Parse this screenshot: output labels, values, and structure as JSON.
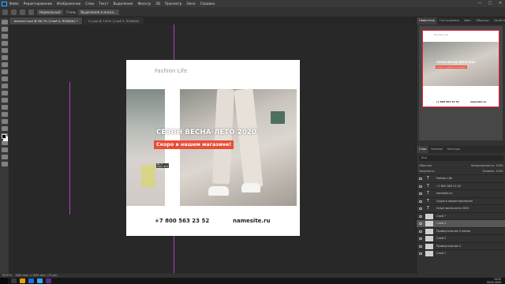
{
  "menu": {
    "items": [
      "Файл",
      "Редактирование",
      "Изображение",
      "Слои",
      "Текст",
      "Выделение",
      "Фильтр",
      "3D",
      "Просмотр",
      "Окно",
      "Справка"
    ],
    "window_controls": {
      "minimize": "—",
      "maximize": "□",
      "close": "✕"
    }
  },
  "options_bar": {
    "mode_label": "Нормальный",
    "style_label": "Стиль",
    "mask_button": "Выделение и маска..."
  },
  "tabs": [
    {
      "label": "banner2.psd @ 66,7% (Слой 4, RGB/8#) *",
      "active": true
    },
    {
      "label": "11.psd @ 100% (Слой 3, RGB/8#)",
      "active": false
    }
  ],
  "document": {
    "brand": "Fashion Life",
    "headline": "СЕЗОН ВЕСНА-ЛЕТО 2020",
    "cta": "Скоро в нашем магазине!",
    "phone": "+7 800 563 23 52",
    "site": "namesite.ru",
    "selection_hint": "Ш: 0 пикс. В: 0 пикс."
  },
  "colors": {
    "cta_bg": "#ea4c36",
    "guide": "#b040c0",
    "panel_bg": "#323232",
    "canvas_bg": "#282828"
  },
  "navigator": {
    "tabs": [
      "Навигатор",
      "Гистограмма",
      "Цвет",
      "Образцы",
      "Свойства"
    ],
    "thumb": {
      "brand": "Fashion Life",
      "headline": "СЕЗОН ВЕСНА-ЛЕТО 2020",
      "cta": "Скоро в нашем магазине!",
      "phone": "+7 800 563 23 52",
      "site": "namesite.ru"
    }
  },
  "layers_panel": {
    "tabs": [
      "Слои",
      "Каналы",
      "Контуры"
    ],
    "search_placeholder": "Вид",
    "blend_mode": "Обычные",
    "opacity": "Непрозрачность: 100%",
    "lock_label": "Закрепить:",
    "fill": "Заливка: 100%",
    "layers": [
      {
        "name": "Fashion Life",
        "type": "text",
        "selected": false
      },
      {
        "name": "+7 800 563 23 52",
        "type": "text",
        "selected": false
      },
      {
        "name": "namesite.ru",
        "type": "text",
        "selected": false
      },
      {
        "name": "Скоро в нашем магазине!",
        "type": "text",
        "selected": false
      },
      {
        "name": "Сезон весна-лето 2020",
        "type": "text",
        "selected": false
      },
      {
        "name": "Слой 7",
        "type": "image",
        "selected": false
      },
      {
        "name": "Слой 4",
        "type": "image",
        "selected": true
      },
      {
        "name": "Прямоугольник 2 копия",
        "type": "shape",
        "selected": false
      },
      {
        "name": "Слой 2",
        "type": "image",
        "selected": false
      },
      {
        "name": "Прямоугольник 2",
        "type": "shape",
        "selected": false
      },
      {
        "name": "Слой 1",
        "type": "image",
        "selected": false
      }
    ]
  },
  "status": {
    "zoom": "66,67%",
    "doc_info": "1080 пикс. x 1080 пикс. (72 ppi)"
  },
  "taskbar": {
    "time": "10:22",
    "date": "18.01.2020"
  }
}
